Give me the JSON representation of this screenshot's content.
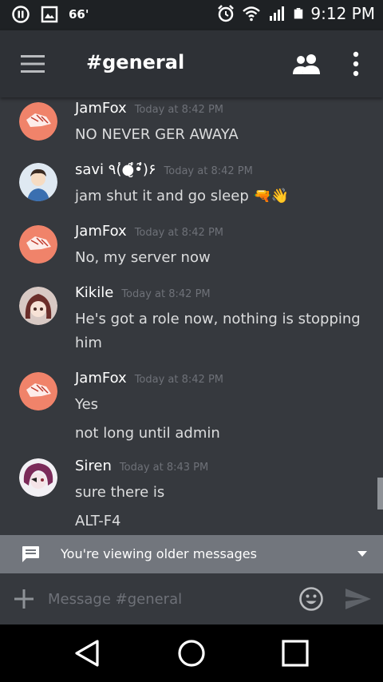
{
  "status_bar": {
    "battery_level": "66'",
    "time": "9:12 PM"
  },
  "header": {
    "channel_title": "#general"
  },
  "messages": [
    {
      "author": "JamFox",
      "timestamp": "Today at 8:42 PM",
      "lines": [
        "NO NEVER GER AWAYA"
      ]
    },
    {
      "author": "savi ٩(̾●̮̮̃̾•̃̾)۶",
      "timestamp": "Today at 8:42 PM",
      "lines": [
        "jam shut it and go sleep 🔫👋"
      ]
    },
    {
      "author": "JamFox",
      "timestamp": "Today at 8:42 PM",
      "lines": [
        "No, my server now"
      ]
    },
    {
      "author": "Kikile",
      "timestamp": "Today at 8:42 PM",
      "lines": [
        "He's got a role now, nothing is stopping",
        "him"
      ]
    },
    {
      "author": "JamFox",
      "timestamp": "Today at 8:42 PM",
      "lines": [
        "Yes",
        "not long until admin"
      ]
    },
    {
      "author": "Siren",
      "timestamp": "Today at 8:43 PM",
      "lines": [
        "sure there is",
        "ALT-F4"
      ]
    }
  ],
  "older_banner": {
    "text": "You're viewing older messages"
  },
  "composer": {
    "placeholder": "Message #general"
  },
  "colors": {
    "background": "#36393e",
    "appbar": "#2e3136",
    "banner": "#72767d"
  }
}
